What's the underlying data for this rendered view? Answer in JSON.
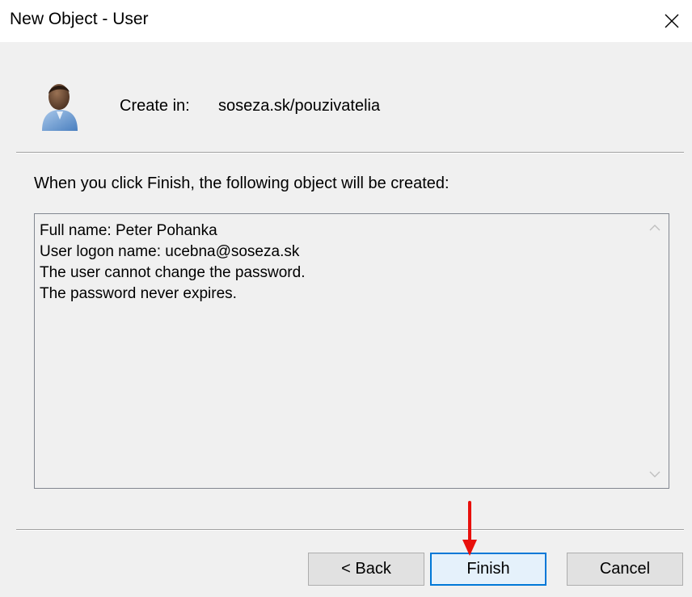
{
  "window": {
    "title": "New Object - User",
    "close_label": "Close"
  },
  "header": {
    "create_in_label": "Create in:",
    "create_in_path": "soseza.sk/pouzivatelia",
    "icon": "user-icon"
  },
  "intro_text": "When you click Finish, the following object will be created:",
  "summary": {
    "lines": [
      "Full name: Peter Pohanka",
      "",
      "User logon name: ucebna@soseza.sk",
      "",
      "The user cannot change the password.",
      "The password never expires."
    ]
  },
  "buttons": {
    "back": "< Back",
    "finish": "Finish",
    "cancel": "Cancel"
  },
  "colors": {
    "annotation_arrow": "#e8100c",
    "focus_border": "#0078d7"
  }
}
